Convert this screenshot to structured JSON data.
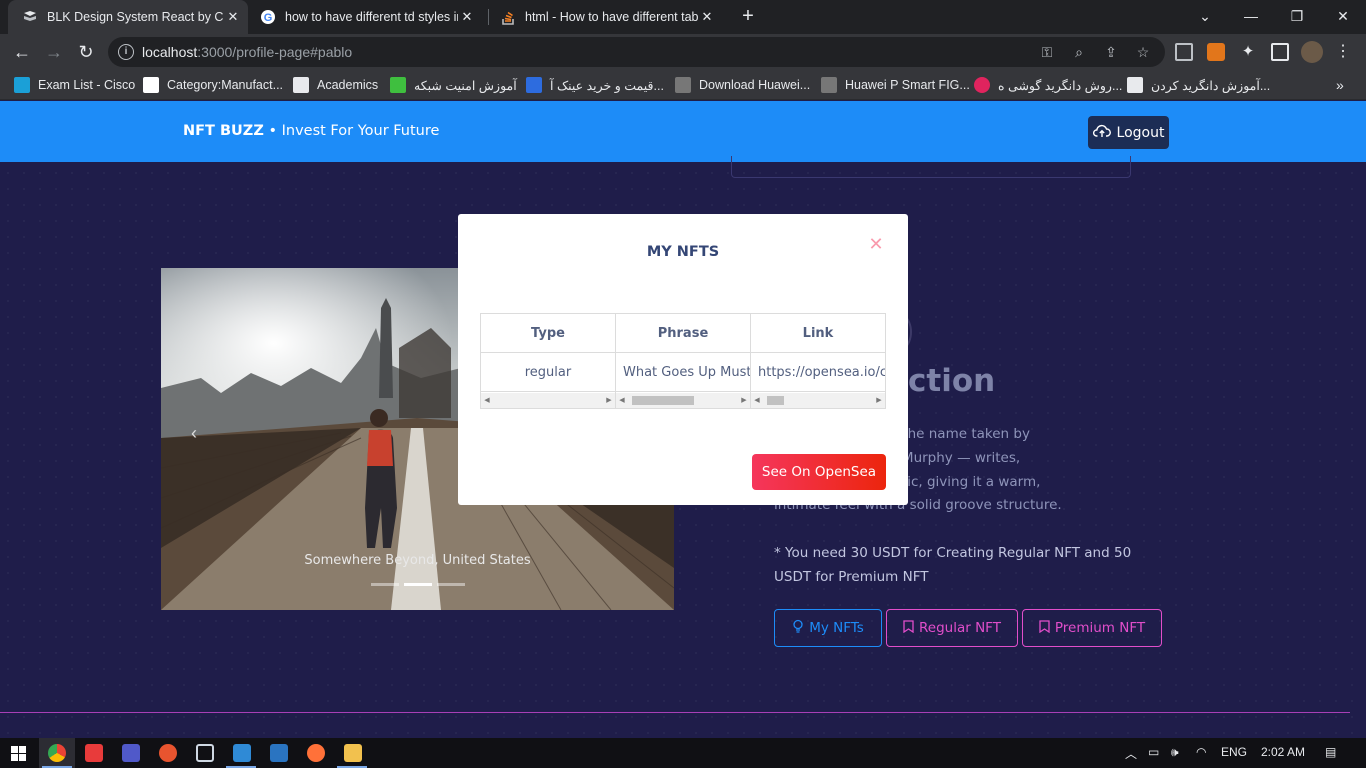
{
  "browser": {
    "tabs": [
      {
        "title": "BLK Design System React by Creat",
        "active": true,
        "favicon": "blk-favicon-icon"
      },
      {
        "title": "how to have different td styles in",
        "active": false,
        "favicon": "google-icon"
      },
      {
        "title": "html - How to have different tabl",
        "active": false,
        "favicon": "stackoverflow-icon"
      }
    ],
    "url_host": "localhost",
    "url_rest": ":3000/profile-page#pablo",
    "bookmarks": [
      {
        "label": "Exam List - Cisco",
        "color": "#1ba0d7"
      },
      {
        "label": "Category:Manufact...",
        "color": "#ffffff"
      },
      {
        "label": "Academics",
        "color": "#e8eaed"
      },
      {
        "label": "آموزش امنیت شبکه",
        "color": "#3fbf3f"
      },
      {
        "label": "قیمت و خرید عینک آ...",
        "color": "#2d6cdf"
      },
      {
        "label": "Download Huawei...",
        "color": "#777777"
      },
      {
        "label": "Huawei P Smart FIG...",
        "color": "#777777"
      },
      {
        "label": "روش دانگرید گوشی ه...",
        "color": "#e0245e"
      },
      {
        "label": "آموزش دانگرید کردن...",
        "color": "#e8eaed"
      }
    ]
  },
  "app": {
    "brand_strong": "NFT BUZZ",
    "brand_rest": " • Invest For Your Future",
    "logout_label": "Logout",
    "carousel_caption": "Somewhere Beyond, United States",
    "profile_title": "ction",
    "profile_text_lines": [
      "ble range, Ryan — the name taken by",
      "ooklyn-based Nick Murphy — writes,",
      "s all of his own music, giving it a warm,",
      "intimate feel with a solid groove structure."
    ],
    "note": "* You need 30 USDT for Creating Regular NFT and 50 USDT for Premium NFT",
    "buttons": {
      "my_nfts": "My NFTs",
      "regular_nft": "Regular NFT",
      "premium_nft": "Premium NFT"
    }
  },
  "modal": {
    "title": "MY NFTS",
    "columns": [
      "Type",
      "Phrase",
      "Link"
    ],
    "rows": [
      {
        "type": "regular",
        "phrase": "What Goes Up Must",
        "link": "https://opensea.io/c"
      }
    ],
    "cta": "See On OpenSea"
  },
  "taskbar": {
    "lang": "ENG",
    "time": "2:02 AM"
  },
  "colors": {
    "nav_blue": "#1d8cf8",
    "page_bg": "#1f1d4a",
    "accent_pink": "#e14eca",
    "danger": "#f5365c"
  }
}
